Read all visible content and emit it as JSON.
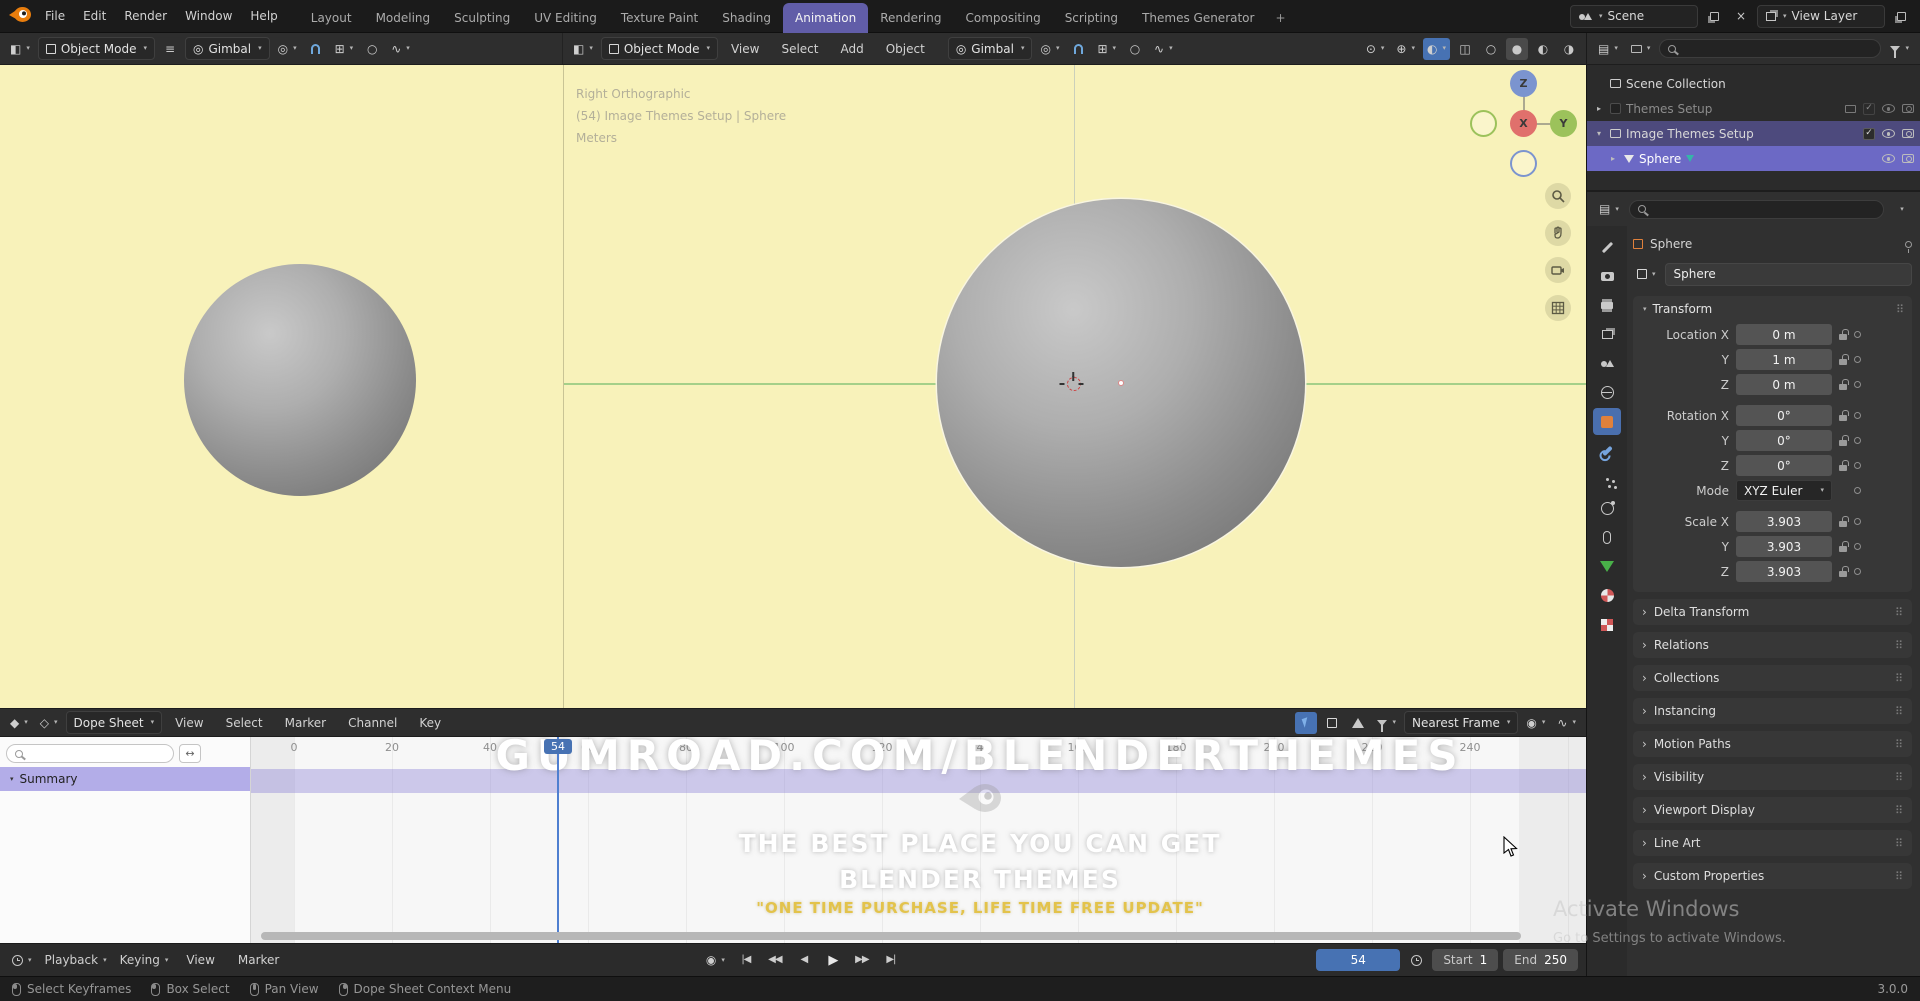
{
  "colors": {
    "accent": "#4772b3",
    "workspace_active": "#615da8",
    "viewport_background": "#f8f2ba",
    "selected_row": "#4d4a7d",
    "active_row": "#6c69c5",
    "watermark_yellow": "#e3c34b"
  },
  "icons": {
    "caret_down": "▾",
    "caret_right": "▸",
    "chevron_right": "›",
    "hamburger": "≡",
    "grip": "⠿",
    "close": "×",
    "check": "✓",
    "expand": "↔",
    "wave": "∿",
    "diamond": "◆",
    "diamond_open": "◇",
    "editor_3d": "◧",
    "editor_list": "▤",
    "snap_to": "⊞",
    "pivot": "◎",
    "record": "◉",
    "gizmo": "⊕",
    "visibility": "⊙",
    "wire_circle": "○",
    "solid_circle": "●",
    "material_circle": "◐",
    "rendered_circle": "◑",
    "xray": "◫",
    "jump_first": "|◀",
    "key_prev": "◀◀",
    "frame_prev": "◀",
    "play": "▶",
    "key_next": "▶▶",
    "jump_last": "▶|"
  },
  "topbar": {
    "menus": [
      "File",
      "Edit",
      "Render",
      "Window",
      "Help"
    ],
    "workspaces": [
      "Layout",
      "Modeling",
      "Sculpting",
      "UV Editing",
      "Texture Paint",
      "Shading",
      "Animation",
      "Rendering",
      "Compositing",
      "Scripting",
      "Themes Generator"
    ],
    "add_workspace": "+",
    "scene": "Scene",
    "view_layer": "View Layer"
  },
  "viewport_header": {
    "mode": "Object Mode",
    "menus": [
      "View",
      "Select",
      "Add",
      "Object"
    ],
    "orientation": "Gimbal"
  },
  "viewport": {
    "view_label": "Right Orthographic",
    "context_label": "(54) Image Themes Setup | Sphere",
    "units_label": "Meters",
    "gizmo": {
      "x": "X",
      "y": "Y",
      "z": "Z"
    }
  },
  "outliner": {
    "rows": [
      {
        "label": "Scene Collection"
      },
      {
        "label": "Themes Setup"
      },
      {
        "label": "Image Themes Setup"
      },
      {
        "label": "Sphere"
      }
    ]
  },
  "properties": {
    "breadcrumb": "Sphere",
    "object_name": "Sphere",
    "transform": {
      "title": "Transform",
      "rows": [
        {
          "label": "Location X",
          "value": "0 m"
        },
        {
          "label": "Y",
          "value": "1 m"
        },
        {
          "label": "Z",
          "value": "0 m"
        },
        {
          "label": "Rotation X",
          "value": "0°"
        },
        {
          "label": "Y",
          "value": "0°"
        },
        {
          "label": "Z",
          "value": "0°"
        },
        {
          "label": "Mode",
          "value": "XYZ Euler"
        },
        {
          "label": "Scale X",
          "value": "3.903"
        },
        {
          "label": "Y",
          "value": "3.903"
        },
        {
          "label": "Z",
          "value": "3.903"
        }
      ]
    },
    "collapsed_panels": [
      "Delta Transform",
      "Relations",
      "Collections",
      "Instancing",
      "Motion Paths",
      "Visibility",
      "Viewport Display",
      "Line Art",
      "Custom Properties"
    ]
  },
  "dopesheet": {
    "editor_label": "Dope Sheet",
    "menus": [
      "View",
      "Select",
      "Marker",
      "Channel",
      "Key"
    ],
    "snap_mode": "Nearest Frame",
    "summary_label": "Summary",
    "ruler_labels": [
      "0",
      "20",
      "40",
      "60",
      "80",
      "100",
      "120",
      "140",
      "160",
      "180",
      "200",
      "220",
      "240"
    ],
    "playhead_frame": "54",
    "watermark": {
      "headline": "GUMROAD.COM/BLENDERTHEMES",
      "line1": "THE BEST PLACE YOU CAN GET",
      "line2": "BLENDER THEMES",
      "line3": "\"ONE TIME PURCHASE, LIFE TIME FREE UPDATE\""
    }
  },
  "timeline": {
    "playback_menu": "Playback",
    "keying_menu": "Keying",
    "view_menu": "View",
    "marker_menu": "Marker",
    "current_frame": "54",
    "start_label": "Start",
    "start_value": "1",
    "end_label": "End",
    "end_value": "250"
  },
  "statusbar": {
    "hints": [
      "Select Keyframes",
      "Box Select",
      "Pan View",
      "Dope Sheet Context Menu"
    ],
    "version": "3.0.0"
  },
  "windows_watermark": {
    "line1": "Activate Windows",
    "line2": "Go to Settings to activate Windows."
  }
}
